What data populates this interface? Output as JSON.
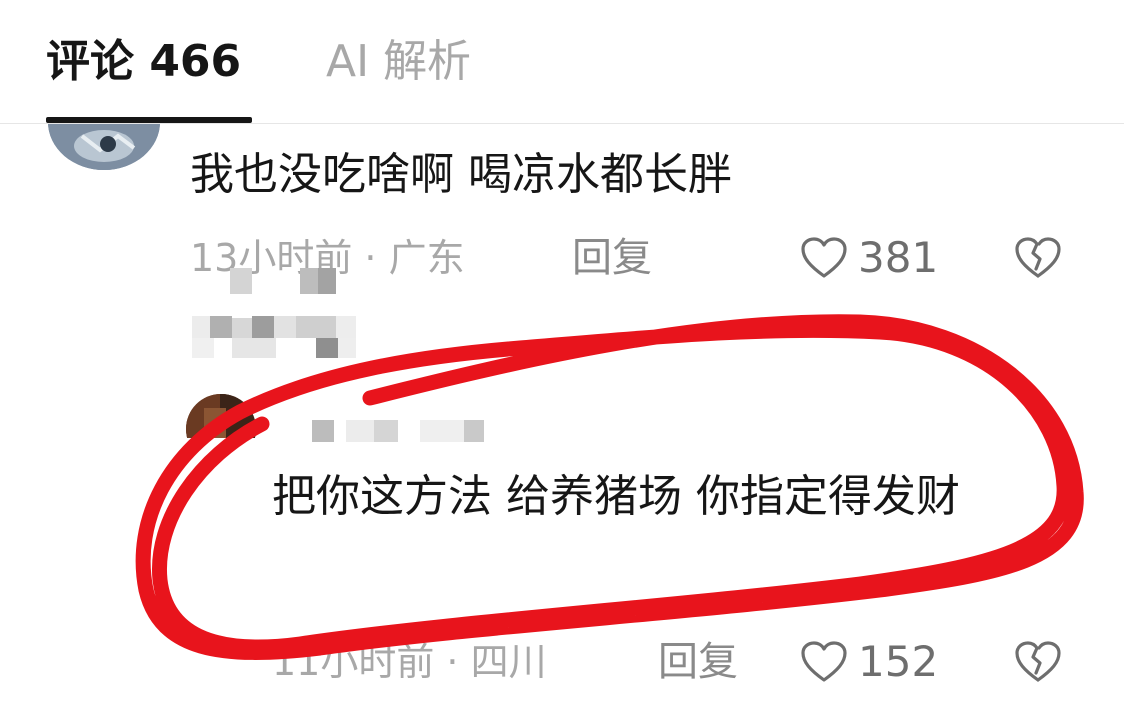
{
  "tabs": {
    "comments_label": "评论 466",
    "ai_label": "AI 解析"
  },
  "comments": [
    {
      "text": "我也没吃啥啊 喝凉水都长胖",
      "meta": "13小时前 · 广东",
      "reply_label": "回复",
      "likes": "381"
    },
    {
      "text": "把你这方法 给养猪场 你指定得发财",
      "meta": "11小时前 · 四川",
      "reply_label": "回复",
      "likes": "152"
    }
  ],
  "icons": {
    "like": "heart-outline-icon",
    "dislike": "broken-heart-icon"
  },
  "colors": {
    "annotation": "#e8141c",
    "primary_text": "#161616",
    "secondary_text": "#a8a8a8"
  }
}
